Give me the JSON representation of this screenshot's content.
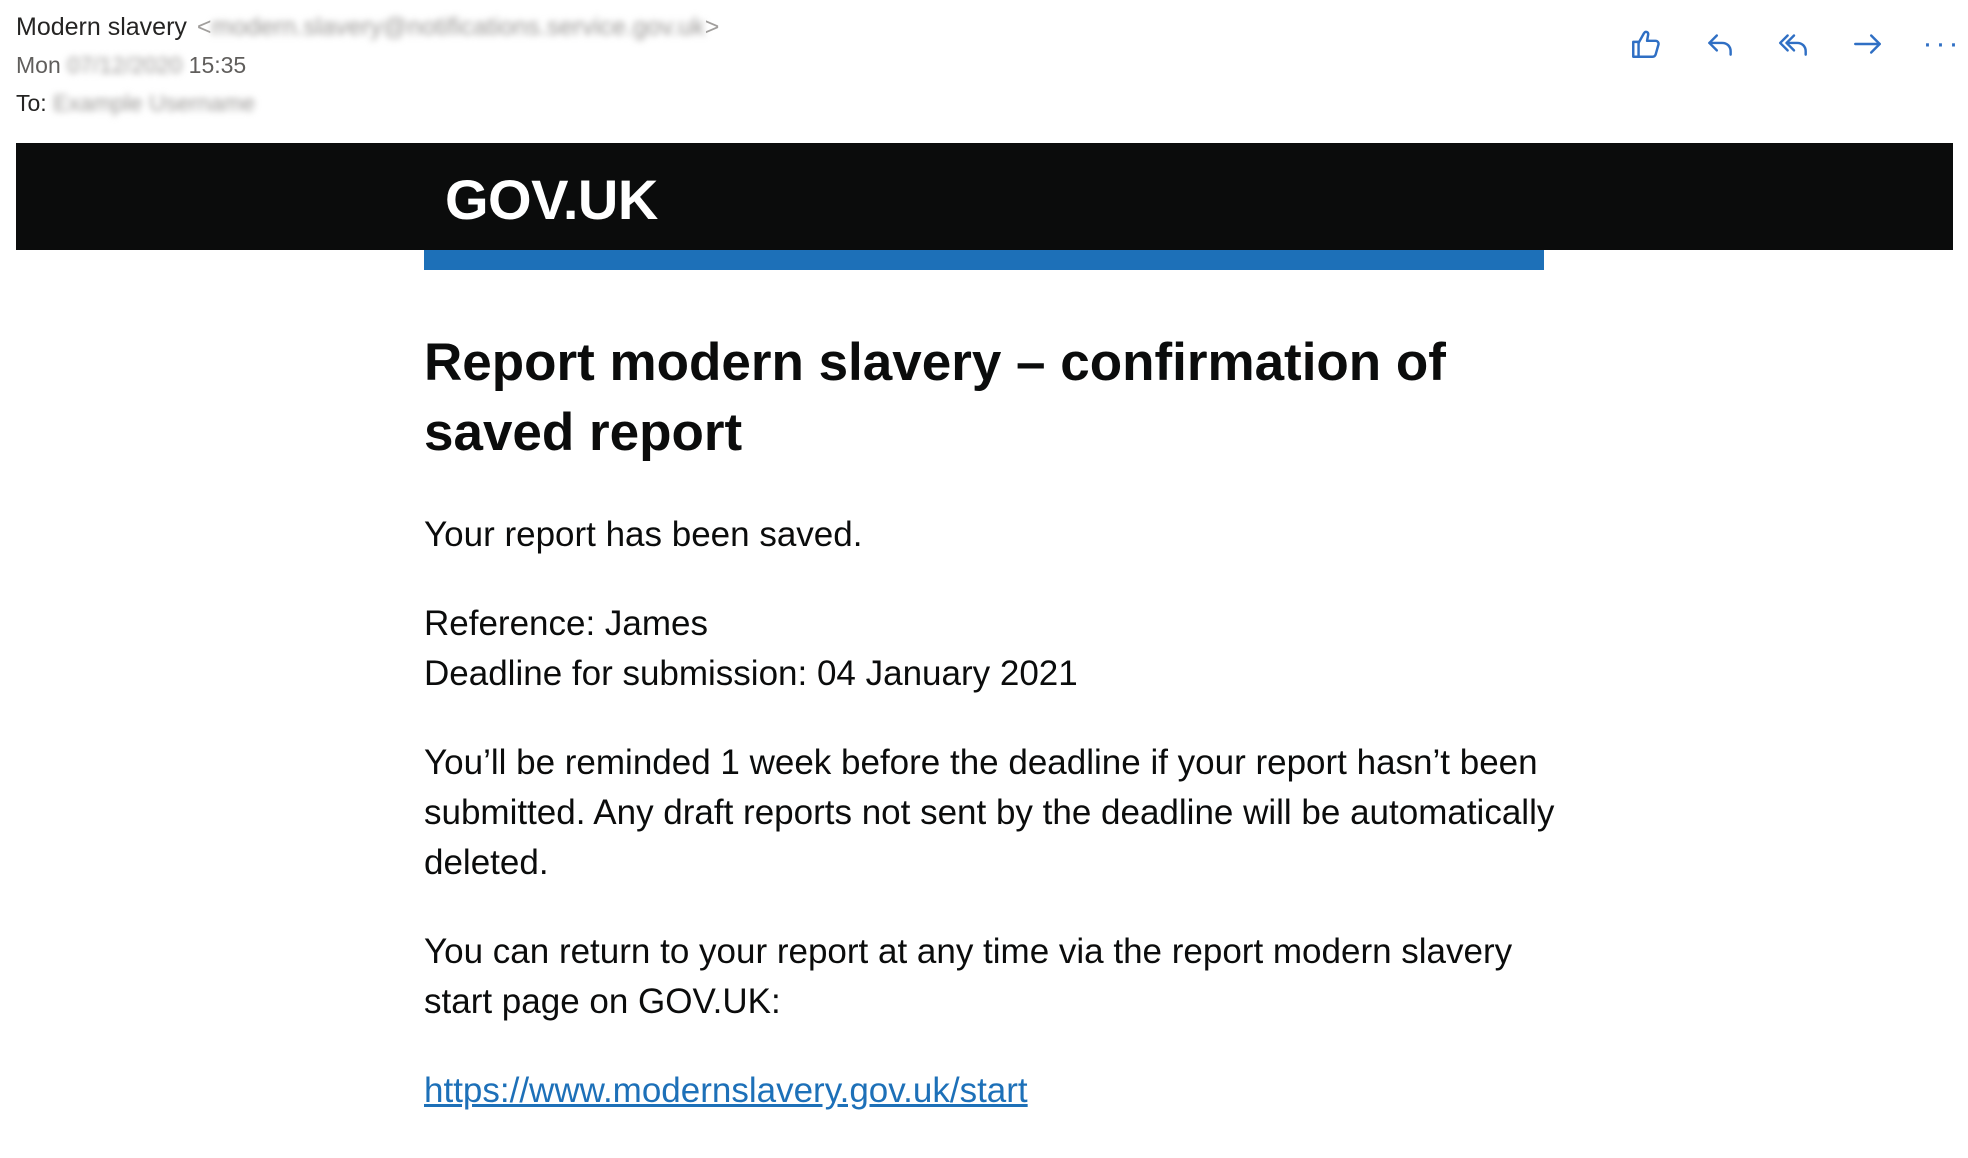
{
  "email": {
    "sender_name": "Modern slavery",
    "sender_address": "modern.slavery@notifications.service.gov.uk",
    "date_day": "Mon",
    "date_value": "07/12/2020",
    "time": "15:35",
    "to_label": "To:",
    "to_value": "Example Username"
  },
  "actions": [
    {
      "name": "like",
      "icon": "thumbs-up-icon"
    },
    {
      "name": "reply",
      "icon": "reply-icon"
    },
    {
      "name": "reply-all",
      "icon": "reply-all-icon"
    },
    {
      "name": "forward",
      "icon": "forward-icon"
    },
    {
      "name": "more",
      "icon": "more-icon",
      "glyph": "···"
    }
  ],
  "brand": {
    "logo_text": "GOV.UK",
    "accent_color": "#1d70b8",
    "bar_color": "#0b0c0c"
  },
  "body": {
    "title": "Report modern slavery – confirmation of saved report",
    "saved_text": "Your report has been saved.",
    "reference_line": "Reference: James",
    "deadline_line": "Deadline for submission: 04 January 2021",
    "reminder_text": "You’ll be reminded 1 week before the deadline if your report hasn’t been submitted. Any draft reports not sent by the deadline will be automatically deleted.",
    "return_text": "You can return to your report at any time via the report modern slavery start page on GOV.UK:",
    "link_text": "https://www.modernslavery.gov.uk/start"
  }
}
